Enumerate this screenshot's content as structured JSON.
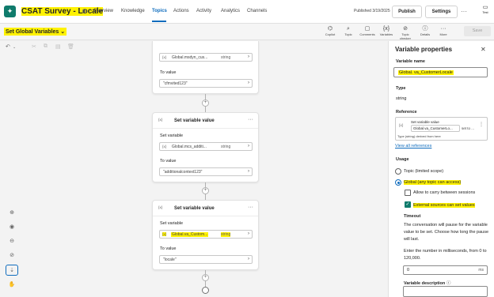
{
  "app": {
    "title": "CSAT Survey - Locale",
    "tabs": [
      "Overview",
      "Knowledge",
      "Topics",
      "Actions",
      "Activity",
      "Analytics",
      "Channels"
    ],
    "active_tab": "Topics",
    "published": "Published 3/19/2025",
    "publish_label": "Publish",
    "settings_label": "Settings",
    "more_glyph": "···",
    "test_label": "Test"
  },
  "toolbar": {
    "topic_name": "Set Global Variables",
    "tools": [
      "Copilot",
      "Topic",
      "Comments",
      "Variables",
      "Topic checker",
      "Details",
      "More"
    ],
    "save_label": "Save"
  },
  "canvas": {
    "nodes": [
      {
        "title": "",
        "set_variable_label": "",
        "variable": "Global.msdyn_cus...",
        "type": "string",
        "to_value_label": "To value",
        "value": "\"cfmvited123\""
      },
      {
        "title": "Set variable value",
        "set_variable_label": "Set variable",
        "variable": "Global.mcs_additi...",
        "type": "string",
        "to_value_label": "To value",
        "value": "\"additionalcontext123\""
      },
      {
        "title": "Set variable value",
        "set_variable_label": "Set variable",
        "variable": "Global.va_Custom...",
        "type": "string",
        "to_value_label": "To value",
        "value": "\"locale\""
      }
    ],
    "x_badge": "{x}",
    "plus_glyph": "+"
  },
  "panel": {
    "title": "Variable properties",
    "variable_name_label": "Variable name",
    "variable_name": "Global.     va_CustomerLocale",
    "type_label": "Type",
    "type_value": "string",
    "reference_label": "Reference",
    "reference_title": "Set variable value",
    "reference_chip": "Global.va_CustomerLo...",
    "reference_suffix": "set to ...",
    "reference_note": "Type (string) derived from here",
    "view_all_references": "View all references",
    "usage_label": "Usage",
    "usage_topic": "Topic (limited scope)",
    "usage_global": "Global (any topic can access)",
    "allow_carry": "Allow to carry between sessions",
    "external_sources": "External sources can set values",
    "timeout_label": "Timeout",
    "timeout_desc": "The conversation will pause for the variable value to be set. Choose how long the pause will last.",
    "timeout_hint": "Enter the number in milliseconds, from 0 to 120,000.",
    "timeout_value": "0",
    "timeout_unit": "ms",
    "description_label": "Variable description"
  }
}
